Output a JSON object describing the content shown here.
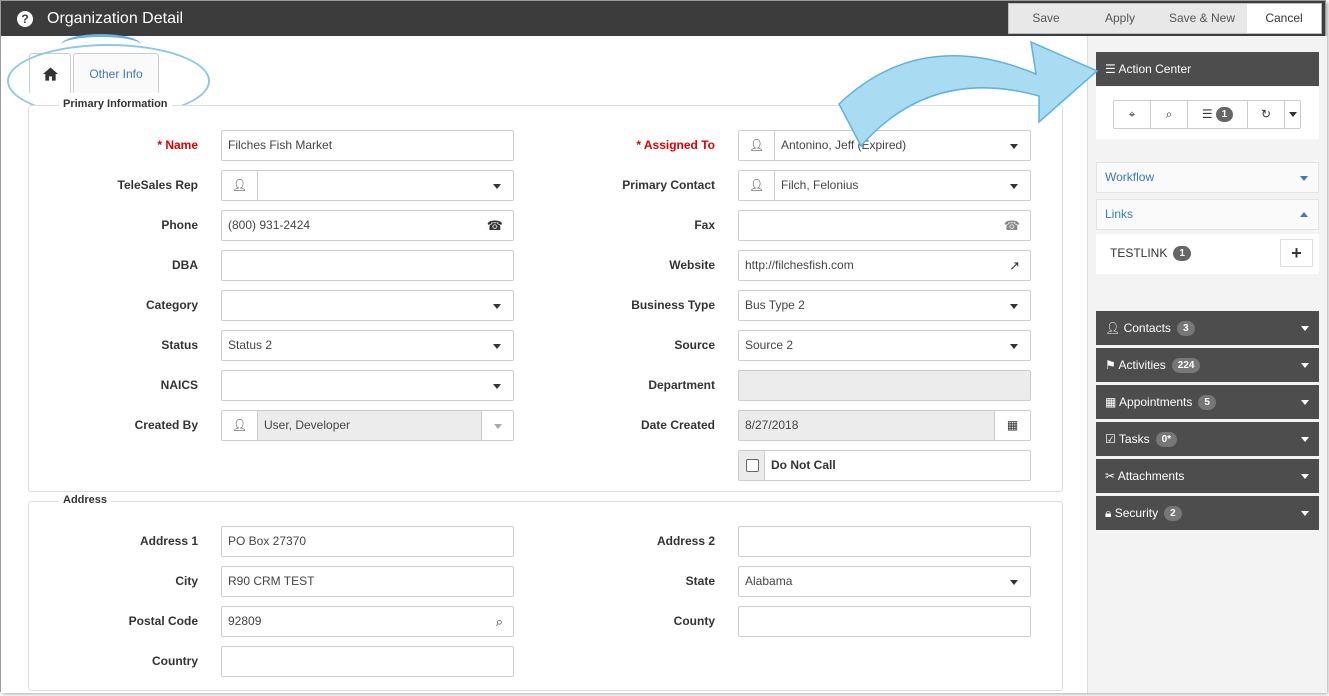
{
  "window": {
    "title": "Organization Detail"
  },
  "toolbar": {
    "save": "Save",
    "apply": "Apply",
    "save_new": "Save & New",
    "cancel": "Cancel"
  },
  "tabs": {
    "other_info": "Other Info"
  },
  "primary": {
    "legend": "Primary Information",
    "labels": {
      "name": "* Name",
      "telesales": "TeleSales Rep",
      "phone": "Phone",
      "dba": "DBA",
      "category": "Category",
      "status": "Status",
      "naics": "NAICS",
      "created_by": "Created By",
      "assigned_to": "* Assigned To",
      "primary_contact": "Primary Contact",
      "fax": "Fax",
      "website": "Website",
      "business_type": "Business Type",
      "source": "Source",
      "department": "Department",
      "date_created": "Date Created"
    },
    "values": {
      "name": "Filches Fish Market",
      "telesales": "",
      "phone": "(800) 931-2424",
      "dba": "",
      "category": "",
      "status": "Status 2",
      "naics": "",
      "created_by": "User, Developer",
      "assigned_to": "Antonino, Jeff (Expired)",
      "primary_contact": "Filch, Felonius",
      "fax": "",
      "website": "http://filchesfish.com",
      "business_type": "Bus Type 2",
      "source": "Source 2",
      "department": "",
      "date_created": "8/27/2018"
    },
    "do_not_call": "Do Not Call"
  },
  "address": {
    "legend": "Address",
    "labels": {
      "address1": "Address 1",
      "city": "City",
      "postal": "Postal Code",
      "country": "Country",
      "address2": "Address 2",
      "state": "State",
      "county": "County"
    },
    "values": {
      "address1": "PO Box 27370",
      "city": "R90 CRM TEST",
      "postal": "92809",
      "country": "",
      "address2": "",
      "state": "Alabama",
      "county": ""
    }
  },
  "action_center": {
    "title": "Action Center",
    "list_count": "1",
    "workflow": "Workflow",
    "links": "Links",
    "link_item": {
      "label": "TESTLINK",
      "count": "1"
    },
    "sections": [
      {
        "label": "Contacts",
        "count": "3"
      },
      {
        "label": "Activities",
        "count": "224"
      },
      {
        "label": "Appointments",
        "count": "5"
      },
      {
        "label": "Tasks",
        "count": "0*"
      },
      {
        "label": "Attachments",
        "count": ""
      },
      {
        "label": "Security",
        "count": "2"
      }
    ]
  },
  "colors": {
    "titlebar": "#3c3c3c",
    "panel_dark": "#4d4d4d",
    "link_blue": "#3d7ab8",
    "required_red": "#dd0000",
    "highlight": "#8cc6e8"
  }
}
